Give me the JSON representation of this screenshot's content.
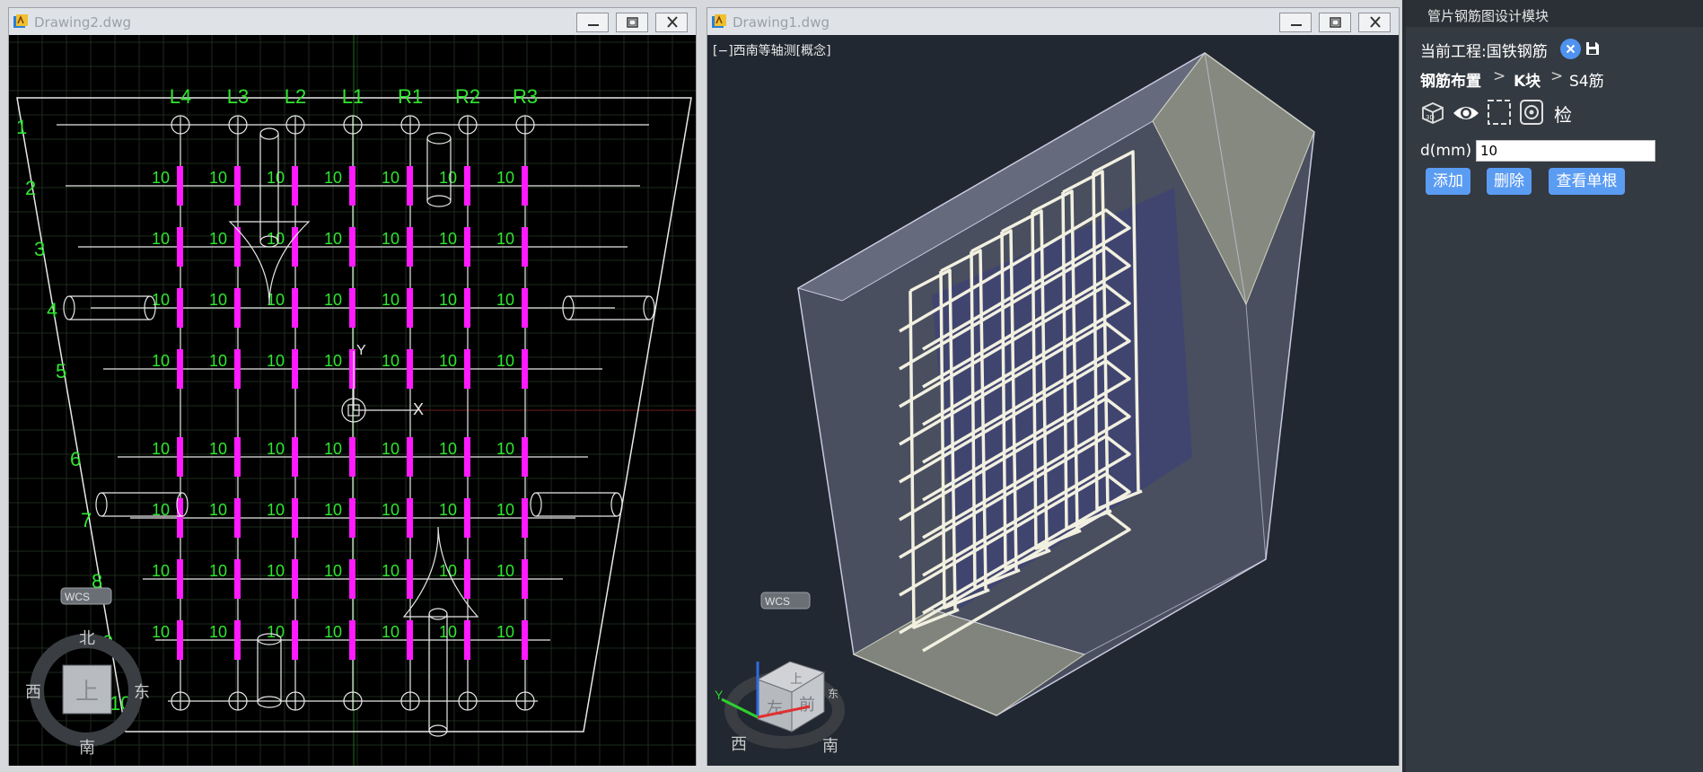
{
  "windows": {
    "left": {
      "title": "Drawing2.dwg"
    },
    "right": {
      "title": "Drawing1.dwg",
      "view_label": "[−]西南等轴测[概念]"
    }
  },
  "plan": {
    "column_labels": [
      "L4",
      "L3",
      "L2",
      "L1",
      "R1",
      "R2",
      "R3"
    ],
    "row_labels": [
      "1",
      "2",
      "3",
      "4",
      "5",
      "6",
      "7",
      "8",
      "9",
      "10"
    ],
    "bar_label": "10",
    "ucs_label": "WCS",
    "compass": {
      "north": "北",
      "south": "南",
      "west": "西",
      "east": "东",
      "top": "上"
    },
    "axis_y": "Y",
    "axis_x": "X"
  },
  "iso": {
    "ucs_label": "WCS",
    "cube_top": "上",
    "cube_left": "左",
    "cube_front": "前",
    "compass_west": "西",
    "compass_south": "南",
    "compass_east": "东"
  },
  "panel": {
    "title": "管片钢筋图设计模块",
    "project_label": "当前工程:国铁钢筋",
    "breadcrumb": [
      "钢筋布置",
      "K块",
      "S4筋"
    ],
    "check_label": "检",
    "d_label": "d(mm)",
    "d_value": "10",
    "buttons": {
      "add": "添加",
      "delete": "删除",
      "view_single": "查看单根"
    }
  },
  "colors": {
    "cad_green": "#2ee62e",
    "cad_magenta": "#ff1aff",
    "panel_bg": "#343a41",
    "button_blue": "#5b9cf3"
  }
}
